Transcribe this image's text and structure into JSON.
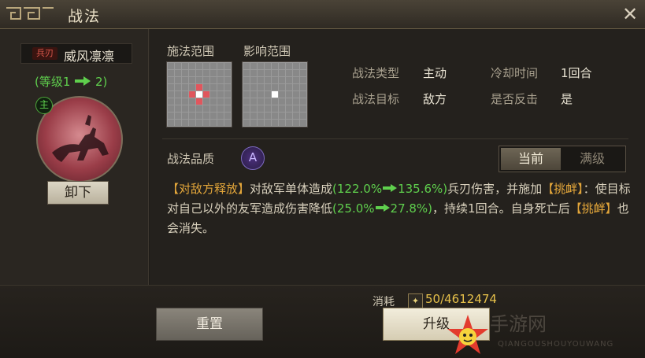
{
  "window": {
    "title": "战法",
    "close_icon": "close-icon"
  },
  "tactic": {
    "weapon_tag": "兵刃",
    "name": "威风凛凛",
    "level_prefix": "(等级1",
    "level_suffix": "2)",
    "general_badge": "主",
    "unequip_label": "卸下"
  },
  "ranges": {
    "cast_label": "施法范围",
    "effect_label": "影响范围"
  },
  "attributes": {
    "type_label": "战法类型",
    "type_value": "主动",
    "cooldown_label": "冷却时间",
    "cooldown_value": "1回合",
    "target_label": "战法目标",
    "target_value": "敌方",
    "counter_label": "是否反击",
    "counter_value": "是"
  },
  "quality": {
    "label": "战法品质",
    "grade": "A",
    "toggle_current": "当前",
    "toggle_max": "满级"
  },
  "description": {
    "tag1": "【对敌方释放】",
    "t1": "对敌军单体造成",
    "dmg_from": "(122.0%",
    "dmg_to": "135.6%)",
    "t2": "兵刃伤害，并施加",
    "tag2": "【挑衅】",
    "t3": "：使目标对自己以外的友军造成伤害降低",
    "red_from": "(25.0%",
    "red_to": "27.8%)",
    "t4": "，持续1回合。自身死亡后",
    "tag3": "【挑衅】",
    "t5": "也会消失。"
  },
  "footer": {
    "cost_label": "消耗",
    "cost_value": "50/4612474",
    "reset_label": "重置",
    "upgrade_label": "升级"
  },
  "watermark": {
    "title": "手游网",
    "sub": "QIANGOUSHOUYOUWANG"
  },
  "colors": {
    "green": "#5fcf4d",
    "orange": "#e3a63a",
    "gold": "#e6c04a",
    "cast_cell": "#e0565d",
    "target_cell": "#ffffff"
  }
}
